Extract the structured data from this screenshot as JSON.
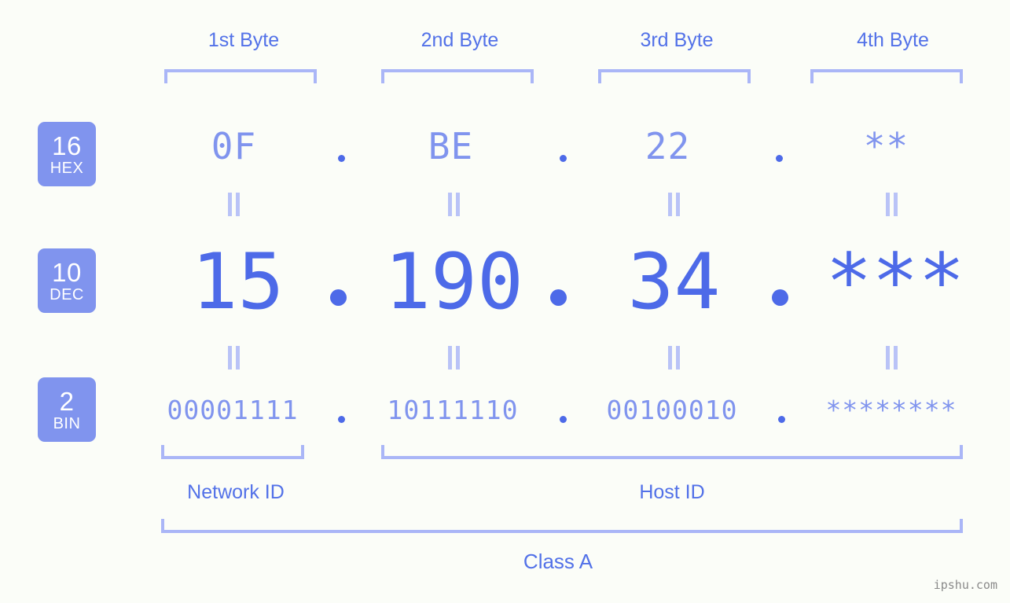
{
  "meta": {
    "watermark": "ipshu.com",
    "background_color": "#fbfdf8",
    "accent_strong": "#4d6ae8",
    "accent_mid": "#5271e8",
    "accent_light": "#8094ee",
    "accent_pale": "#aab6f7",
    "badge_fill": "#8094ee"
  },
  "header": {
    "byte_labels": [
      {
        "label": "1st Byte"
      },
      {
        "label": "2nd Byte"
      },
      {
        "label": "3rd Byte"
      },
      {
        "label": "4th Byte"
      }
    ]
  },
  "rows": [
    {
      "badge_base": "16",
      "badge_name": "HEX",
      "values": [
        "0F",
        "BE",
        "22",
        "**"
      ],
      "separator": "."
    },
    {
      "badge_base": "10",
      "badge_name": "DEC",
      "values": [
        "15",
        "190",
        "34",
        "***"
      ],
      "separator": "."
    },
    {
      "badge_base": "2",
      "badge_name": "BIN",
      "values": [
        "00001111",
        "10111110",
        "00100010",
        "********"
      ],
      "separator": "."
    }
  ],
  "sections": {
    "network_id": "Network ID",
    "host_id": "Host ID",
    "class": "Class A"
  },
  "address": {
    "dec_full": "15.190.34.***",
    "hex_full": "0F.BE.22.**",
    "bin_full": "00001111.10111110.00100010.********"
  }
}
